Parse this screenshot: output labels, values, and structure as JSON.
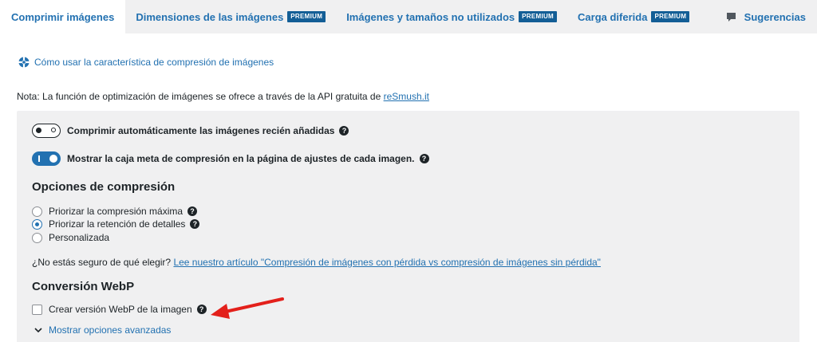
{
  "tabs": [
    {
      "label": "Comprimir imágenes",
      "badge": "",
      "active": true
    },
    {
      "label": "Dimensiones de las imágenes",
      "badge": "PREMIUM",
      "active": false
    },
    {
      "label": "Imágenes y tamaños no utilizados",
      "badge": "PREMIUM",
      "active": false
    },
    {
      "label": "Carga diferida",
      "badge": "PREMIUM",
      "active": false
    }
  ],
  "suggestions_tab": {
    "label": "Sugerencias",
    "icon": "comment-icon"
  },
  "howto_link": {
    "label": "Cómo usar la característica de compresión de imágenes",
    "icon": "help-wheel-icon"
  },
  "note": {
    "text": "Nota: La función de optimización de imágenes se ofrece a través de la API gratuita de ",
    "link": "reSmush.it"
  },
  "toggles": [
    {
      "label": "Comprimir automáticamente las imágenes recién añadidas",
      "on": false
    },
    {
      "label": "Mostrar la caja meta de compresión en la página de ajustes de cada imagen.",
      "on": true
    }
  ],
  "compression_options": {
    "heading": "Opciones de compresión",
    "options": [
      {
        "label": "Priorizar la compresión máxima",
        "checked": false,
        "help": true
      },
      {
        "label": "Priorizar la retención de detalles",
        "checked": true,
        "help": true
      },
      {
        "label": "Personalizada",
        "checked": false,
        "help": false
      }
    ]
  },
  "unsure": {
    "text": "¿No estás seguro de qué elegir? ",
    "link": "Lee nuestro artículo \"Compresión de imágenes con pérdida vs compresión de imágenes sin pérdida\""
  },
  "webp": {
    "heading": "Conversión WebP",
    "checkbox_label": "Crear versión WebP de la imagen",
    "checked": false,
    "advanced_link": "Mostrar opciones avanzadas"
  },
  "help_glyph": "?",
  "colors": {
    "accent": "#2271b1",
    "badge": "#135e96",
    "annotation_arrow": "#e3201b"
  }
}
